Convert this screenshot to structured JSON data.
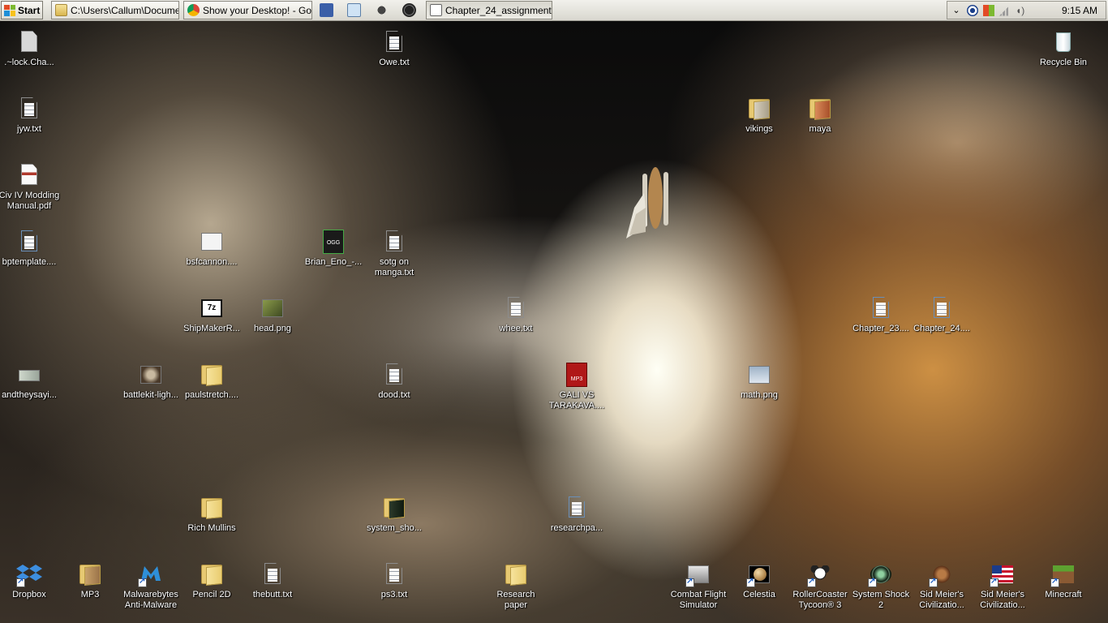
{
  "taskbar": {
    "start_label": "Start",
    "windows": [
      {
        "label": "C:\\Users\\Callum\\Docume...",
        "icon": "folder-icon"
      },
      {
        "label": "Show your Desktop! - Go...",
        "icon": "chrome-icon"
      },
      {
        "label": "Chapter_24_assignment...",
        "icon": "document-icon"
      }
    ],
    "quick_launch": [
      "word-icon",
      "notepad-icon",
      "alienware-icon",
      "steam-icon"
    ],
    "tray_icons": [
      "chevron-icon",
      "eye-icon",
      "windows-flag-icon",
      "signal-icon",
      "volume-icon"
    ],
    "clock": "9:15 AM"
  },
  "desktop": {
    "icons": [
      {
        "label": ".~lock.Cha...",
        "type": "file-grey"
      },
      {
        "label": "Owe.txt",
        "type": "txt"
      },
      {
        "label": "Recycle Bin",
        "type": "recycle-bin"
      },
      {
        "label": "jyw.txt",
        "type": "txt"
      },
      {
        "label": "vikings",
        "type": "folder"
      },
      {
        "label": "maya",
        "type": "folder"
      },
      {
        "label": "Civ IV Modding Manual.pdf",
        "type": "pdf"
      },
      {
        "label": "bptemplate....",
        "type": "doc"
      },
      {
        "label": "bsfcannon....",
        "type": "image"
      },
      {
        "label": "Brian_Eno_-...",
        "type": "ogg"
      },
      {
        "label": "sotg on manga.txt",
        "type": "txt"
      },
      {
        "label": "ShipMakerR...",
        "type": "7z"
      },
      {
        "label": "head.png",
        "type": "image"
      },
      {
        "label": "whee.txt",
        "type": "txt"
      },
      {
        "label": "Chapter_23....",
        "type": "doc"
      },
      {
        "label": "Chapter_24....",
        "type": "doc"
      },
      {
        "label": "andtheysayi...",
        "type": "image"
      },
      {
        "label": "battlekit-ligh...",
        "type": "image"
      },
      {
        "label": "paulstretch....",
        "type": "folder"
      },
      {
        "label": "dood.txt",
        "type": "txt"
      },
      {
        "label": "GALI VS TARAKAVA....",
        "type": "mp3"
      },
      {
        "label": "math.png",
        "type": "image"
      },
      {
        "label": "Rich Mullins",
        "type": "folder"
      },
      {
        "label": "system_sho...",
        "type": "folder"
      },
      {
        "label": "researchpa...",
        "type": "doc"
      },
      {
        "label": "Dropbox",
        "type": "dropbox"
      },
      {
        "label": "MP3",
        "type": "folder"
      },
      {
        "label": "Malwarebytes Anti-Malware",
        "type": "malwarebytes"
      },
      {
        "label": "Pencil 2D",
        "type": "folder"
      },
      {
        "label": "thebutt.txt",
        "type": "txt"
      },
      {
        "label": "ps3.txt",
        "type": "txt"
      },
      {
        "label": "Research paper",
        "type": "folder"
      },
      {
        "label": "Combat Flight Simulator",
        "type": "app"
      },
      {
        "label": "Celestia",
        "type": "app"
      },
      {
        "label": "RollerCoaster Tycoon® 3",
        "type": "app"
      },
      {
        "label": "System Shock 2",
        "type": "app"
      },
      {
        "label": "Sid Meier's Civilizatio...",
        "type": "app"
      },
      {
        "label": "Sid Meier's Civilizatio...",
        "type": "app"
      },
      {
        "label": "Minecraft",
        "type": "app"
      }
    ]
  },
  "colors": {
    "taskbar_bg": "#e3e1d9",
    "folder": "#e9cc70",
    "label_text": "#ffffff"
  }
}
